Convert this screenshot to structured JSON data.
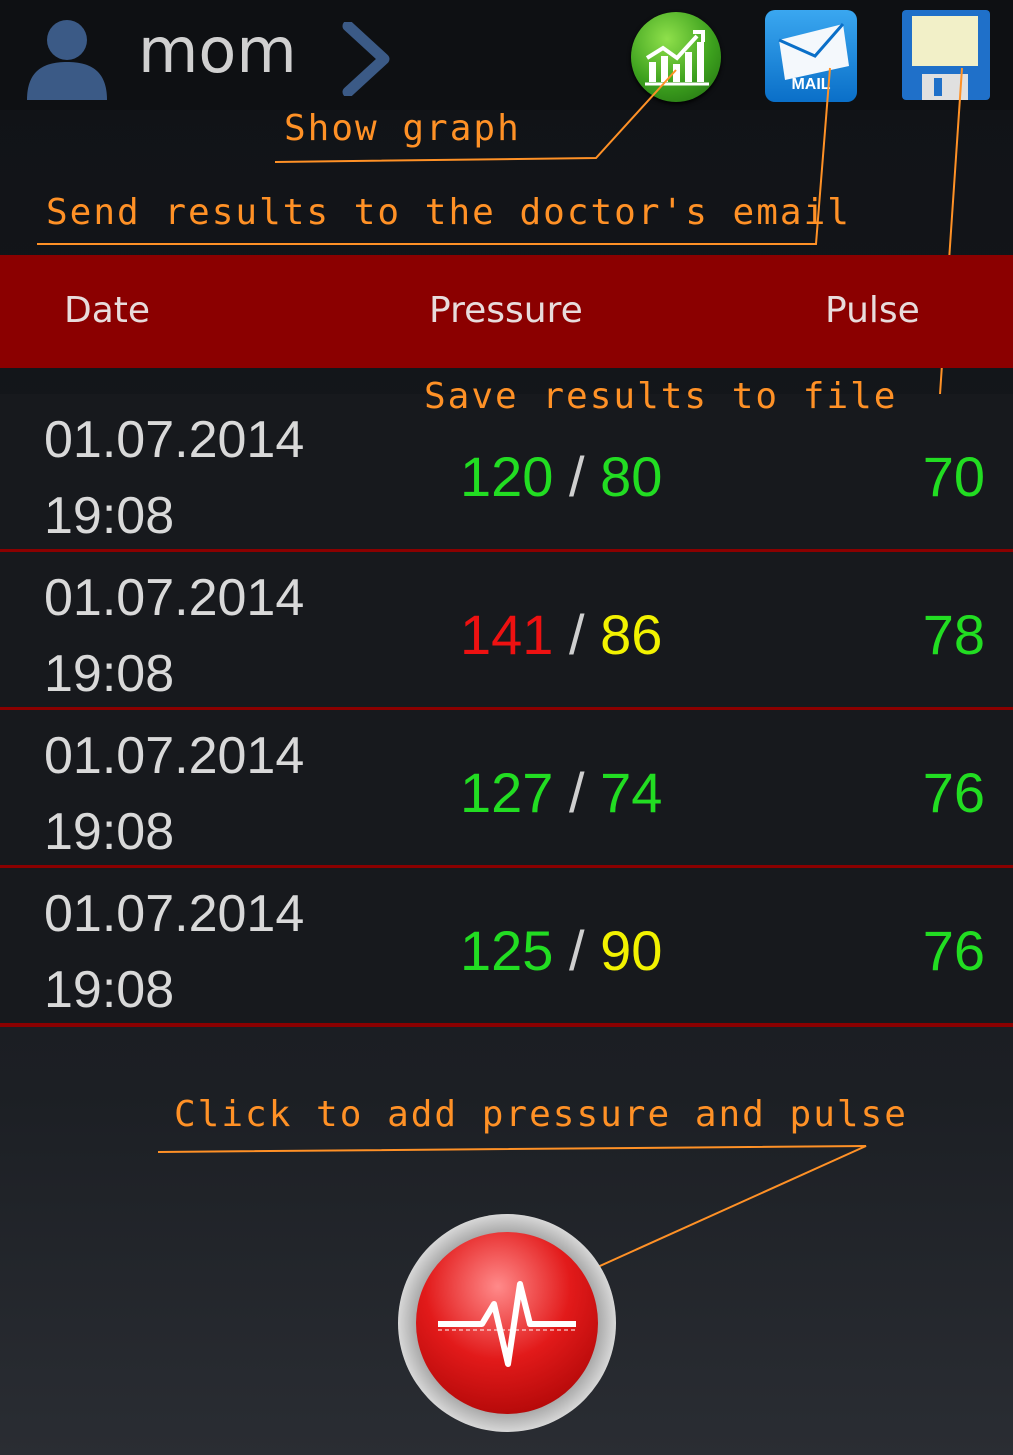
{
  "header": {
    "user_name": "mom",
    "mail_label": "MAIL"
  },
  "annotations": {
    "show_graph": "Show graph",
    "send_email": "Send results to the doctor's email",
    "save_file": "Save results to file",
    "add_entry": "Click to add pressure and pulse"
  },
  "table": {
    "columns": [
      "Date",
      "Pressure",
      "Pulse"
    ],
    "rows": [
      {
        "date": "01.07.2014",
        "time": "19:08",
        "systolic": "120",
        "diastolic": "80",
        "pulse": "70",
        "systolic_color": "#22dd22",
        "diastolic_color": "#22dd22",
        "pulse_color": "#22dd22"
      },
      {
        "date": "01.07.2014",
        "time": "19:08",
        "systolic": "141",
        "diastolic": "86",
        "pulse": "78",
        "systolic_color": "#ee1111",
        "diastolic_color": "#f2f200",
        "pulse_color": "#22dd22"
      },
      {
        "date": "01.07.2014",
        "time": "19:08",
        "systolic": "127",
        "diastolic": "74",
        "pulse": "76",
        "systolic_color": "#22dd22",
        "diastolic_color": "#22dd22",
        "pulse_color": "#22dd22"
      },
      {
        "date": "01.07.2014",
        "time": "19:08",
        "systolic": "125",
        "diastolic": "90",
        "pulse": "76",
        "systolic_color": "#22dd22",
        "diastolic_color": "#f2f200",
        "pulse_color": "#22dd22"
      }
    ]
  },
  "colors": {
    "accent_red": "#8b0000",
    "annotation_orange": "#ff9126",
    "normal_green": "#22dd22",
    "warning_yellow": "#f2f200",
    "high_red": "#ee1111"
  },
  "icons": [
    "user-icon",
    "chevron-right-icon",
    "graph-icon",
    "mail-icon",
    "floppy-save-icon",
    "heartbeat-icon"
  ]
}
